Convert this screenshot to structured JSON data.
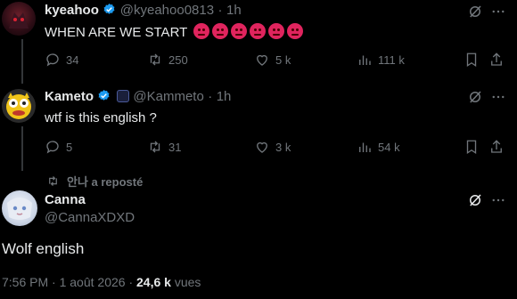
{
  "tweets": [
    {
      "display_name": "kyeahoo",
      "handle": "@kyeahoo0813",
      "sep": "·",
      "time": "1h",
      "text": "WHEN ARE WE START",
      "emoji_count": 6,
      "replies": "34",
      "retweets": "250",
      "likes": "5 k",
      "views": "111 k"
    },
    {
      "display_name": "Kameto",
      "handle": "@Kammeto",
      "sep": "·",
      "time": "1h",
      "text": "wtf is this english ?",
      "replies": "5",
      "retweets": "31",
      "likes": "3 k",
      "views": "54 k"
    }
  ],
  "repost_label": "안나 a reposté",
  "main": {
    "display_name": "Canna",
    "handle": "@CannaXDXD",
    "text": "Wolf english",
    "time": "7:56 PM",
    "sep1": "·",
    "date": "1 août 2026",
    "sep2": "·",
    "views_count": "24,6 k",
    "views_label": "vues"
  },
  "colors": {
    "background": "#000000",
    "text": "#e7e9ea",
    "muted": "#71767b",
    "verified": "#1d9bf0",
    "angry_emoji": "#e0245e"
  }
}
